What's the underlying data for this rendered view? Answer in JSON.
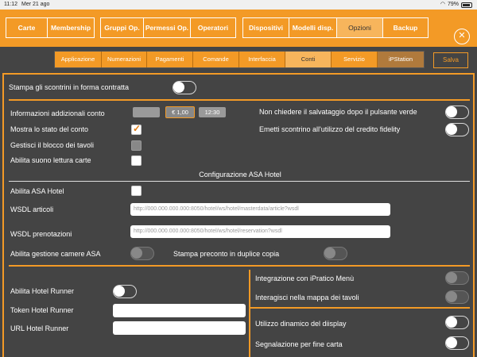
{
  "status_bar": {
    "time": "11:12",
    "date": "Mer 21 ago",
    "battery": "79%"
  },
  "top_nav": {
    "group1": [
      "Carte",
      "Membership"
    ],
    "group2": [
      "Gruppi Op.",
      "Permessi Op.",
      "Operatori"
    ],
    "group3": [
      "Dispositivi",
      "Modelli disp.",
      "Opzioni",
      "Backup"
    ],
    "active": "Opzioni"
  },
  "sub_nav": {
    "tabs": [
      "Applicazione",
      "Numerazioni",
      "Pagamenti",
      "Comande",
      "Interfaccia",
      "Conti",
      "Servizio",
      "iPStation"
    ],
    "active": "Conti",
    "save_label": "Salva"
  },
  "settings": {
    "stampa_scontrini": "Stampa gli scontrini in forma contratta",
    "info_addizionali": "Informazioni addizionali conto",
    "chip_value": "€ 1,00",
    "chip_time": "12:30",
    "mostra_stato": "Mostra lo stato del conto",
    "gestisci_blocco": "Gestisci il blocco dei tavoli",
    "abilita_suono": "Abilita suono lettura carte",
    "non_chiedere": "Non chiedere il salvataggio dopo il pulsante verde",
    "emetti_scontrino": "Emetti scontrino all'utilizzo del credito fidelity"
  },
  "asa": {
    "heading": "Configurazione ASA Hotel",
    "abilita_asa": "Abilita ASA Hotel",
    "wsdl_articoli": "WSDL articoli",
    "wsdl_articoli_placeholder": "http://000.000.000.000:8050/hotel/ws/hotel/masterdata/article?wsdl",
    "wsdl_prenotazioni": "WSDL prenotazioni",
    "wsdl_prenotazioni_placeholder": "http://000.000.000.000:8050/hotel/ws/hotel/reservation?wsdl",
    "abilita_camere": "Abilita gestione camere ASA",
    "stampa_preconto": "Stampa preconto in duplice copia"
  },
  "hotel_runner": {
    "abilita": "Abilita Hotel Runner",
    "token": "Token Hotel Runner",
    "url": "URL Hotel Runner"
  },
  "right_options": {
    "ipratico": "Integrazione con iPratico Menù",
    "interagisci": "Interagisci nella mappa dei tavoli",
    "utilizzo_display": "Utilizzo dinamico del diisplay",
    "segnalazione": "Segnalazione per fine carta"
  },
  "colors": {
    "accent": "#f39a26",
    "background": "#444444"
  },
  "icons": {
    "close": "close-icon",
    "wifi": "wifi-icon",
    "battery": "battery-icon"
  }
}
